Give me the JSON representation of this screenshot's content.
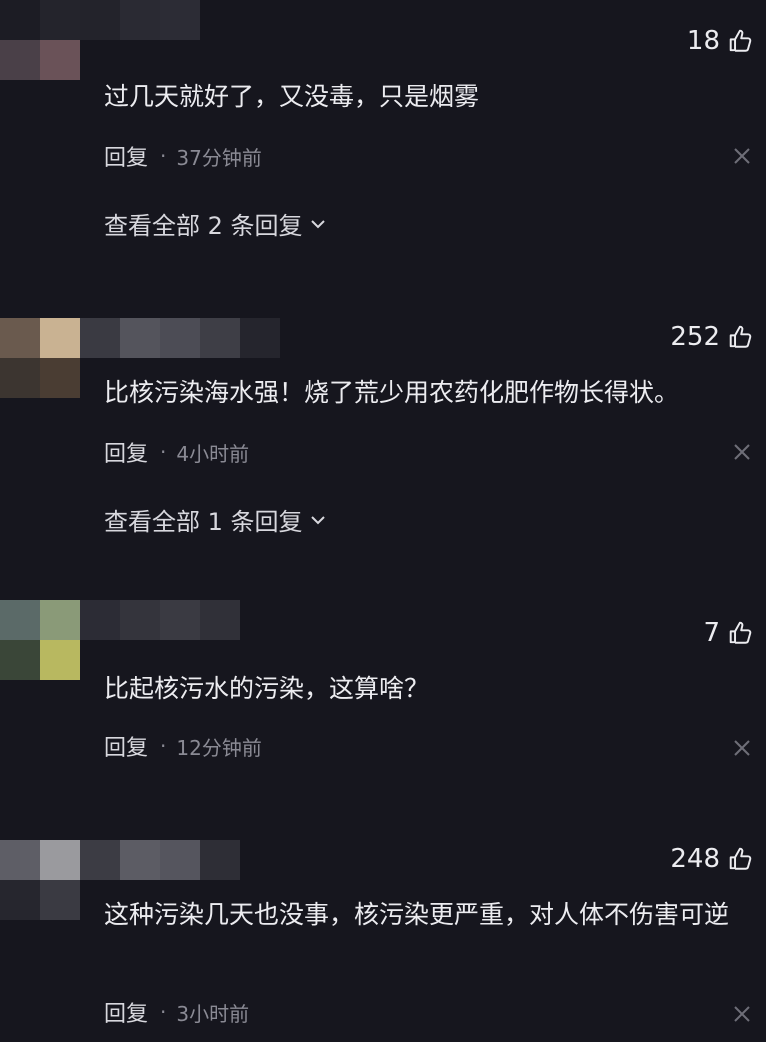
{
  "comments": [
    {
      "likes": "18",
      "text": "过几天就好了，又没毒，只是烟雾",
      "reply_label": "回复",
      "separator": "·",
      "time": "37分钟前",
      "view_all": "查看全部 2 条回复"
    },
    {
      "likes": "252",
      "text": "比核污染海水强！烧了荒少用农药化肥作物长得状。",
      "reply_label": "回复",
      "separator": "·",
      "time": "4小时前",
      "view_all": "查看全部 1 条回复"
    },
    {
      "likes": "7",
      "text": "比起核污水的污染，这算啥？",
      "reply_label": "回复",
      "separator": "·",
      "time": "12分钟前"
    },
    {
      "likes": "248",
      "text": "这种污染几天也没事，核污染更严重，对人体不伤害可逆",
      "reply_label": "回复",
      "separator": "·",
      "time": "3小时前"
    }
  ],
  "icons": {
    "like": "thumbs-up-icon",
    "close": "close-icon",
    "expand": "chevron-down-icon"
  },
  "colors": {
    "background": "#16161e",
    "text": "#ececf0",
    "meta": "#8a8a94"
  }
}
